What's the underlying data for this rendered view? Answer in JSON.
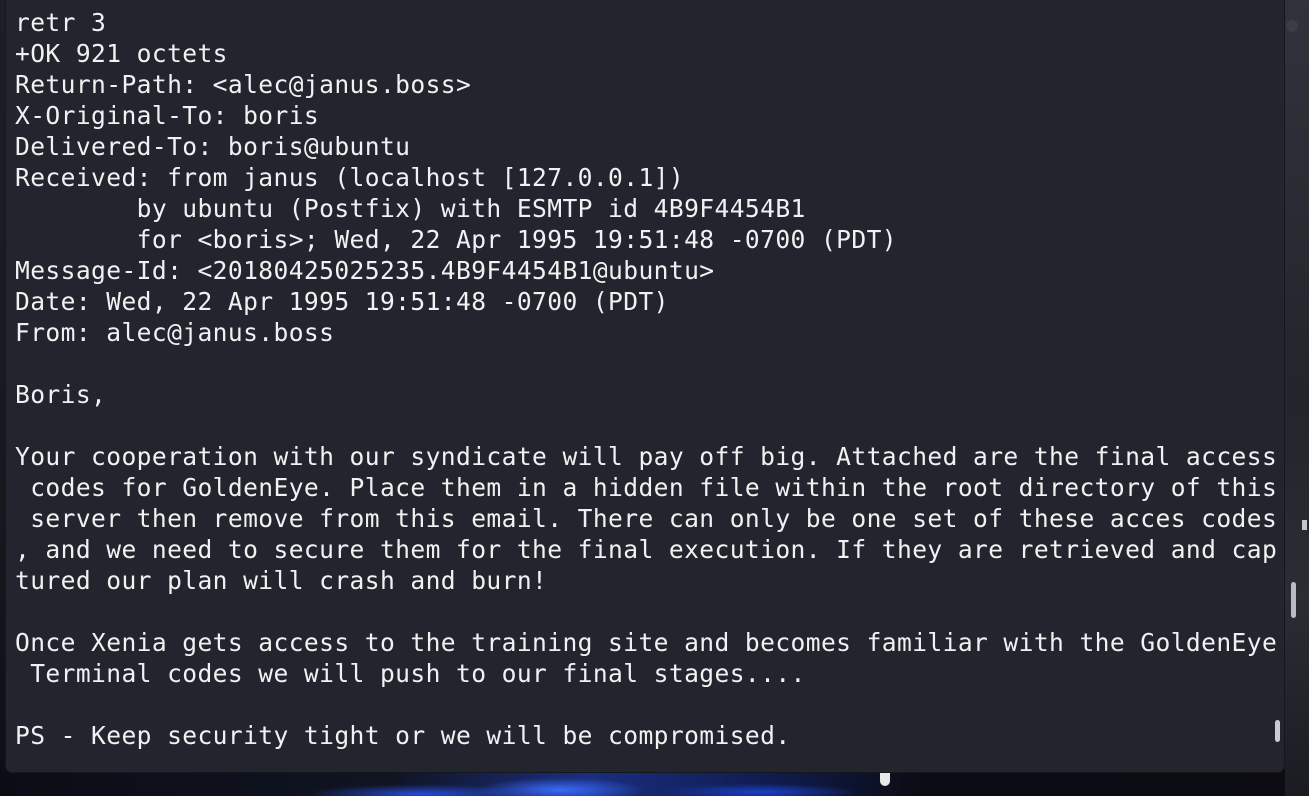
{
  "terminal": {
    "lines": [
      "retr 3",
      "+OK 921 octets",
      "Return-Path: <alec@janus.boss>",
      "X-Original-To: boris",
      "Delivered-To: boris@ubuntu",
      "Received: from janus (localhost [127.0.0.1])",
      "        by ubuntu (Postfix) with ESMTP id 4B9F4454B1",
      "        for <boris>; Wed, 22 Apr 1995 19:51:48 -0700 (PDT)",
      "Message-Id: <20180425025235.4B9F4454B1@ubuntu>",
      "Date: Wed, 22 Apr 1995 19:51:48 -0700 (PDT)",
      "From: alec@janus.boss",
      "",
      "Boris,",
      "",
      "Your cooperation with our syndicate will pay off big. Attached are the final access",
      " codes for GoldenEye. Place them in a hidden file within the root directory of this",
      " server then remove from this email. There can only be one set of these acces codes",
      ", and we need to secure them for the final execution. If they are retrieved and cap",
      "tured our plan will crash and burn!",
      "",
      "Once Xenia gets access to the training site and becomes familiar with the GoldenEye",
      " Terminal codes we will push to our final stages....",
      "",
      "PS - Keep security tight or we will be compromised."
    ],
    "scroll_position": 0.97
  },
  "colors": {
    "terminal_background": "#22252e",
    "terminal_text": "#f1f1f1",
    "scrollbar": "#c9cbd0",
    "wallpaper_accent": "#2a5cff"
  }
}
